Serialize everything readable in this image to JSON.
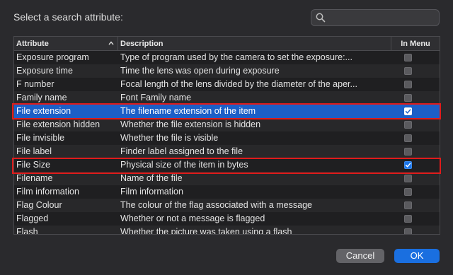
{
  "dialog": {
    "prompt": "Select a search attribute:",
    "search": {
      "placeholder": "",
      "icon": "search-icon"
    }
  },
  "table": {
    "columns": {
      "attribute": "Attribute",
      "description": "Description",
      "in_menu": "In Menu"
    },
    "sort_icon": "chevron-up-icon",
    "rows": [
      {
        "attribute": "Exposure program",
        "description": "Type of program used by the camera to set the exposure:...",
        "in_menu": false,
        "selected": false
      },
      {
        "attribute": "Exposure time",
        "description": "Time the lens was open during exposure",
        "in_menu": false,
        "selected": false
      },
      {
        "attribute": "F number",
        "description": "Focal length of the lens divided by the diameter of the aper...",
        "in_menu": false,
        "selected": false
      },
      {
        "attribute": "Family name",
        "description": "Font Family name",
        "in_menu": false,
        "selected": false
      },
      {
        "attribute": "File extension",
        "description": "The filename extension of the item",
        "in_menu": true,
        "selected": true
      },
      {
        "attribute": "File extension hidden",
        "description": "Whether the file extension is hidden",
        "in_menu": false,
        "selected": false
      },
      {
        "attribute": "File invisible",
        "description": "Whether the file is visible",
        "in_menu": false,
        "selected": false
      },
      {
        "attribute": "File label",
        "description": "Finder label assigned to the file",
        "in_menu": false,
        "selected": false
      },
      {
        "attribute": "File Size",
        "description": "Physical size of the item in bytes",
        "in_menu": true,
        "selected": false
      },
      {
        "attribute": "Filename",
        "description": "Name of the file",
        "in_menu": false,
        "selected": false
      },
      {
        "attribute": "Film information",
        "description": "Film information",
        "in_menu": false,
        "selected": false
      },
      {
        "attribute": "Flag Colour",
        "description": "The colour of the flag associated with a message",
        "in_menu": false,
        "selected": false
      },
      {
        "attribute": "Flagged",
        "description": "Whether or not a message is flagged",
        "in_menu": false,
        "selected": false
      },
      {
        "attribute": "Flash",
        "description": "Whether the picture was taken using a flash",
        "in_menu": false,
        "selected": false
      }
    ]
  },
  "annotations": {
    "highlight_color": "#e01b1b"
  },
  "buttons": {
    "cancel": "Cancel",
    "ok": "OK"
  },
  "colors": {
    "selection": "#1c5fc7",
    "accent": "#1a6fe0",
    "background": "#2a2a2d"
  }
}
